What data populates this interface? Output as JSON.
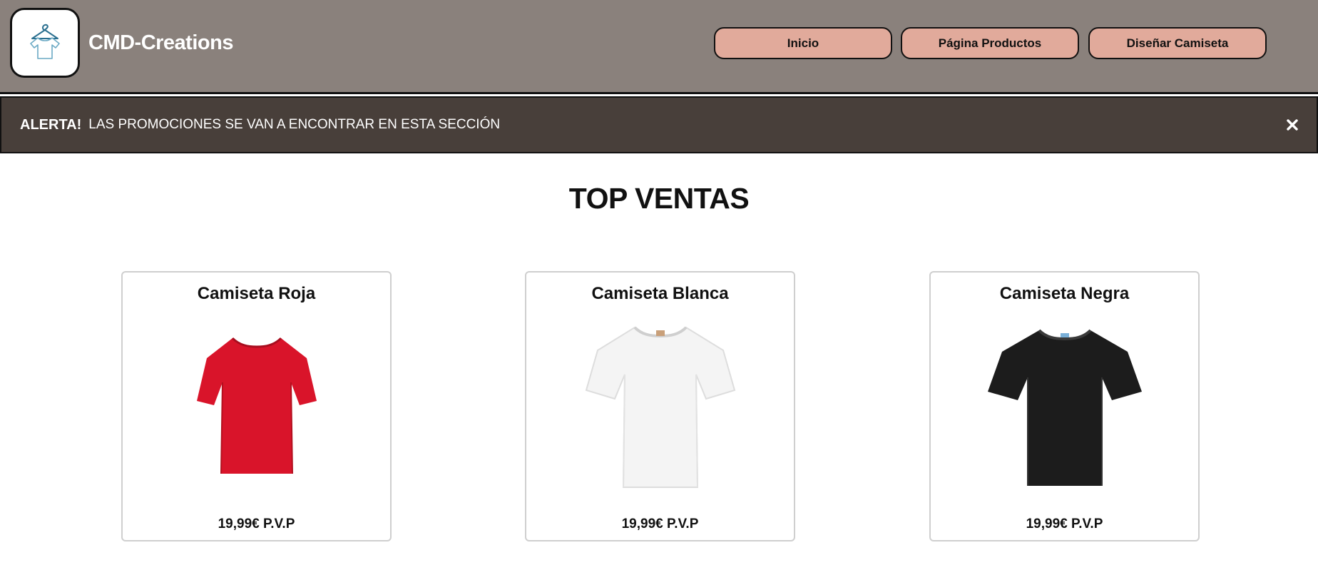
{
  "header": {
    "brand": "CMD-Creations",
    "logo_icon": "tshirt-hanger-icon",
    "nav": [
      {
        "label": "Inicio"
      },
      {
        "label": "Página Productos"
      },
      {
        "label": "Diseñar Camiseta"
      }
    ],
    "colors": {
      "background": "#8a817c",
      "button": "#e1aa9b"
    }
  },
  "alert": {
    "strong": "ALERTA!",
    "text": "LAS PROMOCIONES SE VAN A ENCONTRAR EN ESTA SECCIÓN",
    "close_icon": "close-icon",
    "colors": {
      "background": "#483f3a"
    }
  },
  "main": {
    "title": "TOP VENTAS",
    "products": [
      {
        "name": "Camiseta Roja",
        "price": "19,99€ P.V.P",
        "color": "#d9142a"
      },
      {
        "name": "Camiseta Blanca",
        "price": "19,99€ P.V.P",
        "color": "#f2f2f2"
      },
      {
        "name": "Camiseta Negra",
        "price": "19,99€ P.V.P",
        "color": "#1c1c1c"
      }
    ]
  }
}
